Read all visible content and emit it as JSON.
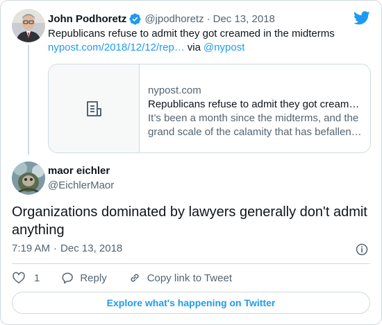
{
  "parent": {
    "author_name": "John Podhoretz",
    "handle": "@jpodhoretz",
    "date": "Dec 13, 2018",
    "text": "Republicans refuse to admit they got creamed in the midterms",
    "link_text": "nypost.com/2018/12/12/rep…",
    "via": "via",
    "via_handle": "@nypost"
  },
  "link_card": {
    "domain": "nypost.com",
    "title": "Republicans refuse to admit they got cream…",
    "description_line1": "It’s been a month since the midterms, and the",
    "description_line2": "grand scale of the calamity that has befallen…"
  },
  "reply": {
    "author_name": "maor eichler",
    "handle": "@EichlerMaor",
    "text": "Organizations dominated by lawyers generally don't admit anything",
    "time": "7:19 AM",
    "separator": "·",
    "date": "Dec 13, 2018"
  },
  "actions": {
    "like_count": "1",
    "reply_label": "Reply",
    "copy_link_label": "Copy link to Tweet"
  },
  "explore_label": "Explore what's happening on Twitter",
  "colors": {
    "accent": "#1d9bf0",
    "secondary_text": "#536471",
    "border": "#cfd9de"
  },
  "icons": [
    "verified-badge-icon",
    "twitter-bird-icon",
    "article-icon",
    "info-icon",
    "heart-icon",
    "reply-icon",
    "link-icon"
  ]
}
